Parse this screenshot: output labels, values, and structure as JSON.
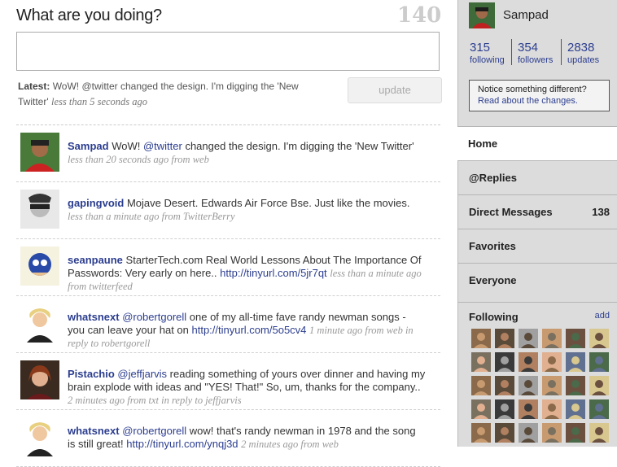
{
  "composer": {
    "question": "What are you doing?",
    "char_count": "140",
    "latest_label": "Latest:",
    "latest_text": "WoW! @twitter changed the design. I'm digging the 'New Twitter'",
    "latest_time": "less than 5 seconds ago",
    "update_label": "update"
  },
  "timeline": [
    {
      "user": "Sampad",
      "parts": [
        {
          "t": "text",
          "v": "WoW! "
        },
        {
          "t": "mention",
          "v": "@twitter"
        },
        {
          "t": "text",
          "v": " changed the design. I'm digging the 'New Twitter'"
        }
      ],
      "meta": "less than 20 seconds ago from web"
    },
    {
      "user": "gapingvoid",
      "parts": [
        {
          "t": "text",
          "v": "Mojave Desert. Edwards Air Force Bse. Just like the movies."
        }
      ],
      "meta": "less than a minute ago from TwitterBerry"
    },
    {
      "user": "seanpaune",
      "parts": [
        {
          "t": "text",
          "v": "StarterTech.com Real World Lessons About The Importance Of Passwords: Very early on here.. "
        },
        {
          "t": "link",
          "v": "http://tinyurl.com/5jr7qt"
        }
      ],
      "meta": "less than a minute ago from twitterfeed"
    },
    {
      "user": "whatsnext",
      "parts": [
        {
          "t": "mention",
          "v": "@robertgorell"
        },
        {
          "t": "text",
          "v": " one of my all-time fave randy newman songs - you can leave your hat on "
        },
        {
          "t": "link",
          "v": "http://tinyurl.com/5o5cv4"
        }
      ],
      "meta": "1 minute ago from web in reply to robertgorell"
    },
    {
      "user": "Pistachio",
      "parts": [
        {
          "t": "mention",
          "v": "@jeffjarvis"
        },
        {
          "t": "text",
          "v": " reading something of yours over dinner and having my brain explode with ideas and \"YES! That!\" So, um, thanks for the company.."
        }
      ],
      "meta": "2 minutes ago from txt in reply to jeffjarvis"
    },
    {
      "user": "whatsnext",
      "parts": [
        {
          "t": "mention",
          "v": "@robertgorell"
        },
        {
          "t": "text",
          "v": " wow! that's randy newman in 1978 and the song is still great! "
        },
        {
          "t": "link",
          "v": "http://tinyurl.com/ynqj3d"
        }
      ],
      "meta": "2 minutes ago from web"
    }
  ],
  "sidebar": {
    "name": "Sampad",
    "stats": [
      {
        "num": "315",
        "label": "following"
      },
      {
        "num": "354",
        "label": "followers"
      },
      {
        "num": "2838",
        "label": "updates"
      }
    ],
    "notice_text": "Notice something different?",
    "notice_link": "Read about the changes.",
    "nav": [
      {
        "label": "Home",
        "count": ""
      },
      {
        "label": "@Replies",
        "count": ""
      },
      {
        "label": "Direct Messages",
        "count": "138"
      },
      {
        "label": "Favorites",
        "count": ""
      },
      {
        "label": "Everyone",
        "count": ""
      }
    ],
    "following_title": "Following",
    "following_add": "add"
  },
  "colors": {
    "link": "#2c3e8f",
    "sidebar_bg": "#dcdcdc",
    "avatar_tones": [
      "#8a6a4a",
      "#5a4a3a",
      "#a0a0a0",
      "#c89a70",
      "#6b5040",
      "#d8c890",
      "#7a7060",
      "#3a3a3a",
      "#b08060",
      "#e0b090",
      "#607090",
      "#4a6a4a"
    ]
  }
}
